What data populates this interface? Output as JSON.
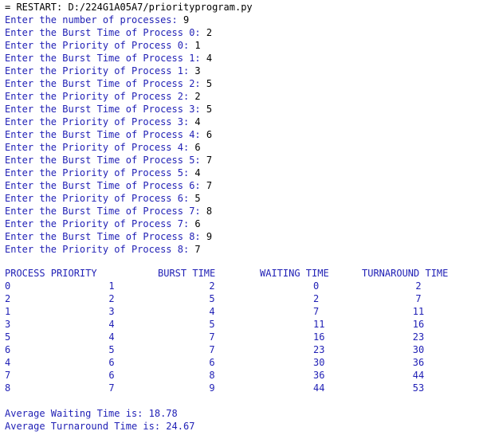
{
  "console": {
    "restart_line": "= RESTART: D:/224G1A05A7/priorityprogram.py",
    "prompts": [
      {
        "text": "Enter the number of processes: ",
        "value": "9"
      },
      {
        "text": "Enter the Burst Time of Process 0: ",
        "value": "2"
      },
      {
        "text": "Enter the Priority of Process 0: ",
        "value": "1"
      },
      {
        "text": "Enter the Burst Time of Process 1: ",
        "value": "4"
      },
      {
        "text": "Enter the Priority of Process 1: ",
        "value": "3"
      },
      {
        "text": "Enter the Burst Time of Process 2: ",
        "value": "5"
      },
      {
        "text": "Enter the Priority of Process 2: ",
        "value": "2"
      },
      {
        "text": "Enter the Burst Time of Process 3: ",
        "value": "5"
      },
      {
        "text": "Enter the Priority of Process 3: ",
        "value": "4"
      },
      {
        "text": "Enter the Burst Time of Process 4: ",
        "value": "6"
      },
      {
        "text": "Enter the Priority of Process 4: ",
        "value": "6"
      },
      {
        "text": "Enter the Burst Time of Process 5: ",
        "value": "7"
      },
      {
        "text": "Enter the Priority of Process 5: ",
        "value": "4"
      },
      {
        "text": "Enter the Burst Time of Process 6: ",
        "value": "7"
      },
      {
        "text": "Enter the Priority of Process 6: ",
        "value": "5"
      },
      {
        "text": "Enter the Burst Time of Process 7: ",
        "value": "8"
      },
      {
        "text": "Enter the Priority of Process 7: ",
        "value": "6"
      },
      {
        "text": "Enter the Burst Time of Process 8: ",
        "value": "9"
      },
      {
        "text": "Enter the Priority of Process 8: ",
        "value": "7"
      }
    ],
    "table": {
      "headers": {
        "process_priority": "PROCESS PRIORITY",
        "burst": "BURST TIME",
        "waiting": "WAITING TIME",
        "turnaround": "TURNAROUND TIME"
      },
      "rows": [
        {
          "process": "0",
          "priority": "1",
          "burst": "2",
          "waiting": "0",
          "turnaround": "2"
        },
        {
          "process": "2",
          "priority": "2",
          "burst": "5",
          "waiting": "2",
          "turnaround": "7"
        },
        {
          "process": "1",
          "priority": "3",
          "burst": "4",
          "waiting": "7",
          "turnaround": "11"
        },
        {
          "process": "3",
          "priority": "4",
          "burst": "5",
          "waiting": "11",
          "turnaround": "16"
        },
        {
          "process": "5",
          "priority": "4",
          "burst": "7",
          "waiting": "16",
          "turnaround": "23"
        },
        {
          "process": "6",
          "priority": "5",
          "burst": "7",
          "waiting": "23",
          "turnaround": "30"
        },
        {
          "process": "4",
          "priority": "6",
          "burst": "6",
          "waiting": "30",
          "turnaround": "36"
        },
        {
          "process": "7",
          "priority": "6",
          "burst": "8",
          "waiting": "36",
          "turnaround": "44"
        },
        {
          "process": "8",
          "priority": "7",
          "burst": "9",
          "waiting": "44",
          "turnaround": "53"
        }
      ]
    },
    "average_waiting": "Average Waiting Time is: 18.78",
    "average_turnaround": "Average Turnaround Time is: 24.67"
  },
  "colors": {
    "output_text": "#1f1fb5",
    "input_text": "#000000",
    "background": "#ffffff"
  }
}
